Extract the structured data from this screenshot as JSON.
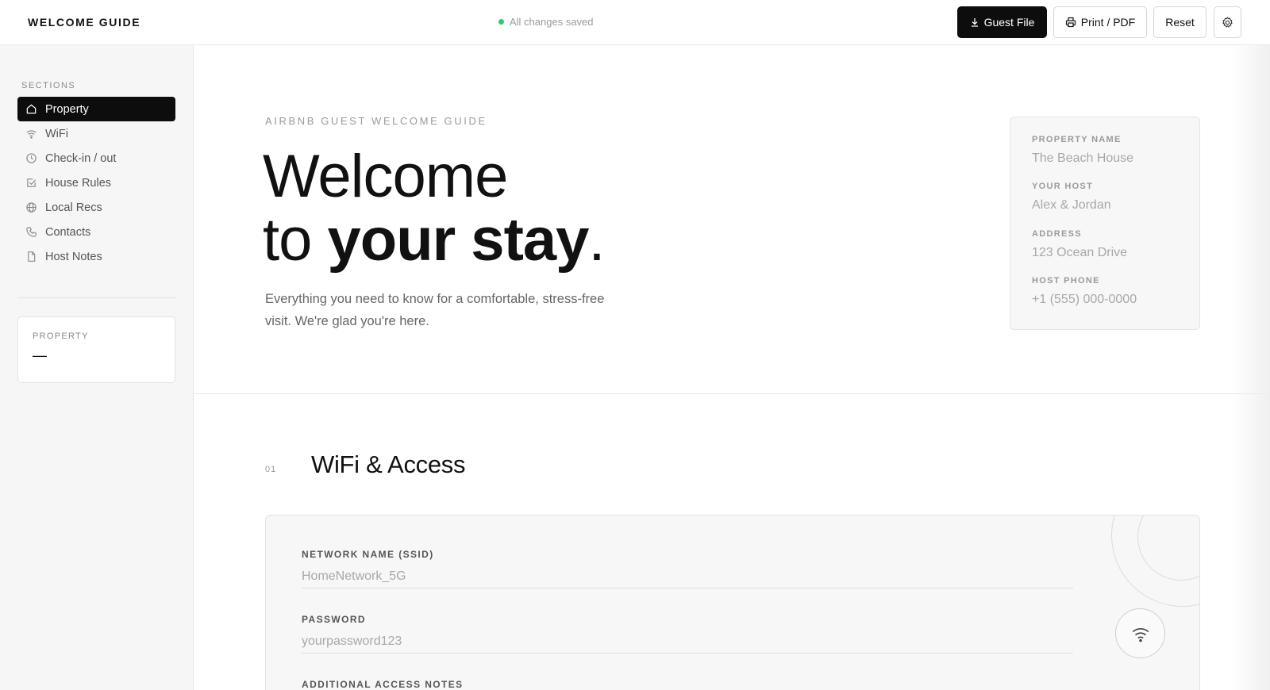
{
  "header": {
    "app_title": "WELCOME GUIDE",
    "save_status": "All changes saved",
    "status_color": "#2ecc71",
    "buttons": {
      "guest_file": "Guest File",
      "print_pdf": "Print / PDF",
      "reset": "Reset"
    }
  },
  "sidebar": {
    "heading": "SECTIONS",
    "items": [
      {
        "label": "Property",
        "icon": "home-icon",
        "active": true
      },
      {
        "label": "WiFi",
        "icon": "wifi-icon",
        "active": false
      },
      {
        "label": "Check-in / out",
        "icon": "clock-icon",
        "active": false
      },
      {
        "label": "House Rules",
        "icon": "checkbox-icon",
        "active": false
      },
      {
        "label": "Local Recs",
        "icon": "globe-icon",
        "active": false
      },
      {
        "label": "Contacts",
        "icon": "phone-icon",
        "active": false
      },
      {
        "label": "Host Notes",
        "icon": "document-icon",
        "active": false
      }
    ],
    "property_card": {
      "label": "PROPERTY",
      "value": "—"
    }
  },
  "hero": {
    "eyebrow": "AIRBNB GUEST WELCOME GUIDE",
    "title_line1": "Welcome",
    "title_line2_prefix": "to ",
    "title_line2_bold": "your stay",
    "title_line2_suffix": ".",
    "subtitle": "Everything you need to know for a comfortable, stress-free visit. We're glad you're here."
  },
  "info_card": {
    "fields": [
      {
        "label": "PROPERTY NAME",
        "value": "The Beach House"
      },
      {
        "label": "YOUR HOST",
        "value": "Alex & Jordan"
      },
      {
        "label": "ADDRESS",
        "value": "123 Ocean Drive"
      },
      {
        "label": "HOST PHONE",
        "value": "+1 (555) 000-0000"
      }
    ]
  },
  "wifi_section": {
    "number": "01",
    "title": "WiFi & Access",
    "network_label": "NETWORK NAME (SSID)",
    "network_placeholder": "HomeNetwork_5G",
    "password_label": "PASSWORD",
    "password_placeholder": "yourpassword123",
    "notes_label": "ADDITIONAL ACCESS NOTES"
  }
}
